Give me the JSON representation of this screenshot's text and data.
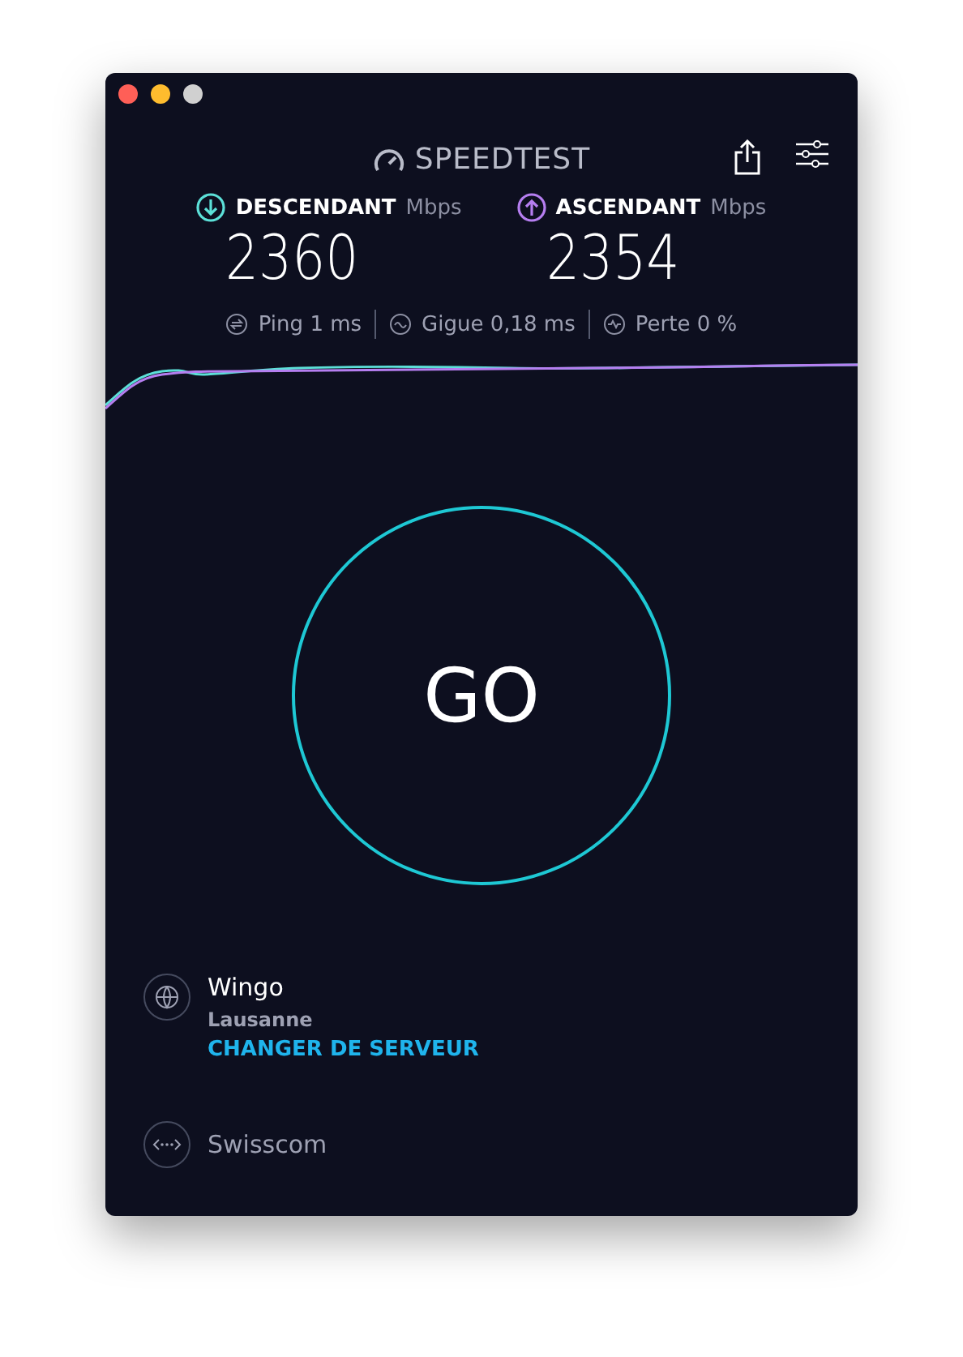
{
  "header": {
    "logo": "SPEEDTEST"
  },
  "metrics": [
    {
      "label": "DESCENDANT",
      "unit": "Mbps",
      "value": "2360",
      "color": "#5ce0d8"
    },
    {
      "label": "ASCENDANT",
      "unit": "Mbps",
      "value": "2354",
      "color": "#b57ef0"
    }
  ],
  "stats": [
    {
      "kind": "ping",
      "label": "Ping",
      "value": "1 ms"
    },
    {
      "kind": "jitter",
      "label": "Gigue",
      "value": "0,18 ms"
    },
    {
      "kind": "loss",
      "label": "Perte",
      "value": "0 %"
    }
  ],
  "go_button": {
    "label": "GO"
  },
  "server": {
    "name": "Wingo",
    "location": "Lausanne",
    "change_link": "CHANGER DE SERVEUR"
  },
  "provider": {
    "name": "Swisscom"
  }
}
